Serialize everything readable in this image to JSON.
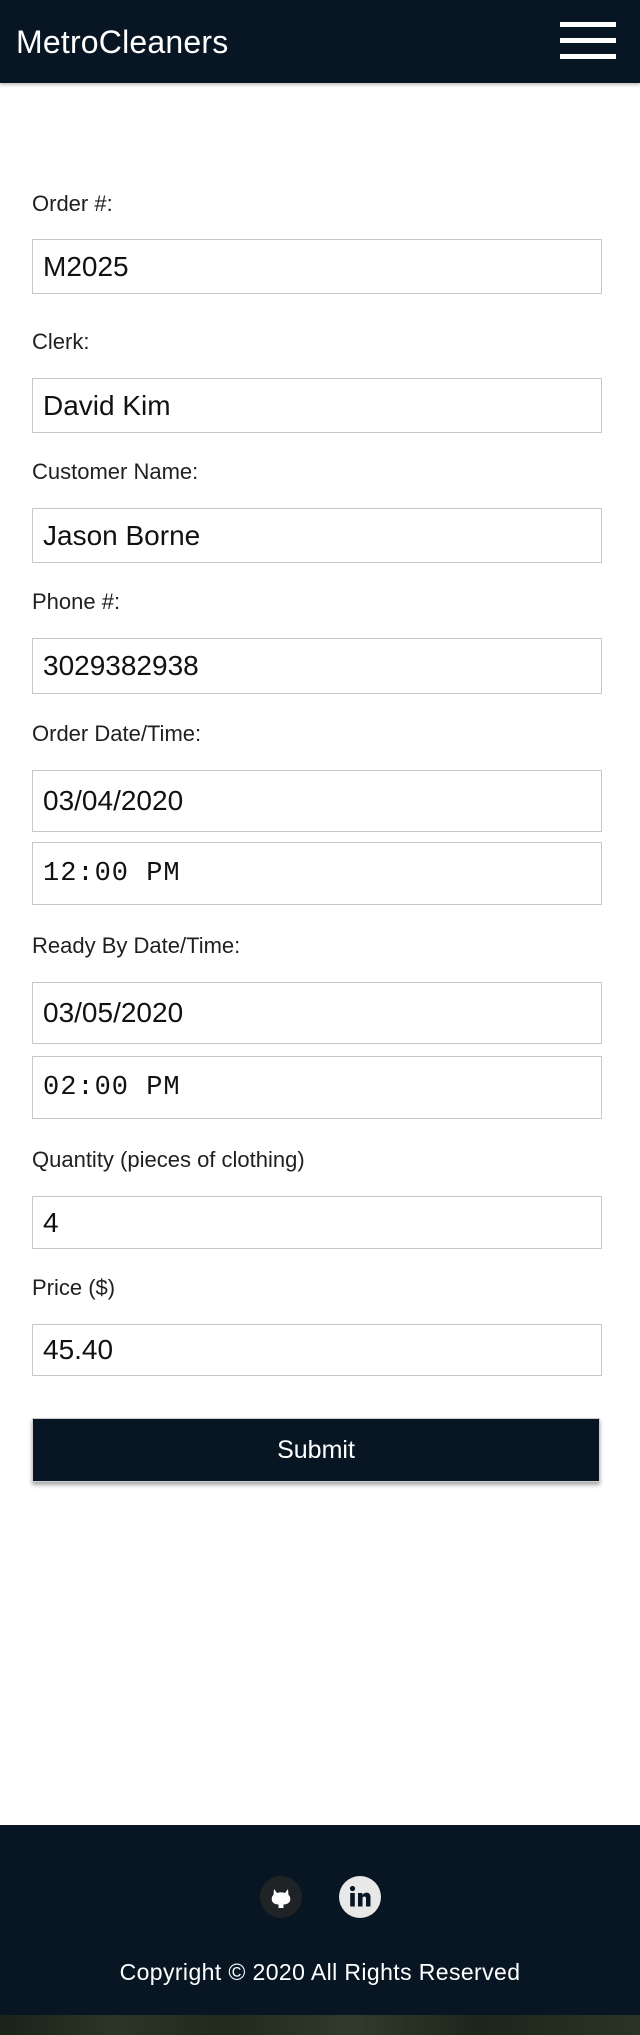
{
  "navbar": {
    "brand": "MetroCleaners",
    "menu_icon": "hamburger-menu-icon",
    "background": "#081624"
  },
  "form": {
    "order_number": {
      "label": "Order #:",
      "value": "M2025"
    },
    "clerk": {
      "label": "Clerk:",
      "value": "David Kim"
    },
    "customer_name": {
      "label": "Customer Name:",
      "value": "Jason Borne"
    },
    "phone": {
      "label": "Phone #:",
      "value": "3029382938"
    },
    "order_datetime": {
      "label": "Order Date/Time:",
      "date": "03/04/2020",
      "time": "12:00 PM"
    },
    "ready_datetime": {
      "label": "Ready By Date/Time:",
      "date": "03/05/2020",
      "time": "02:00 PM"
    },
    "quantity": {
      "label": "Quantity (pieces of clothing)",
      "value": "4"
    },
    "price": {
      "label": "Price ($)",
      "value": "45.40"
    },
    "submit_label": "Submit"
  },
  "footer": {
    "social": [
      {
        "icon": "github-icon"
      },
      {
        "icon": "linkedin-icon"
      }
    ],
    "copyright": "Copyright © 2020 All Rights Reserved"
  }
}
